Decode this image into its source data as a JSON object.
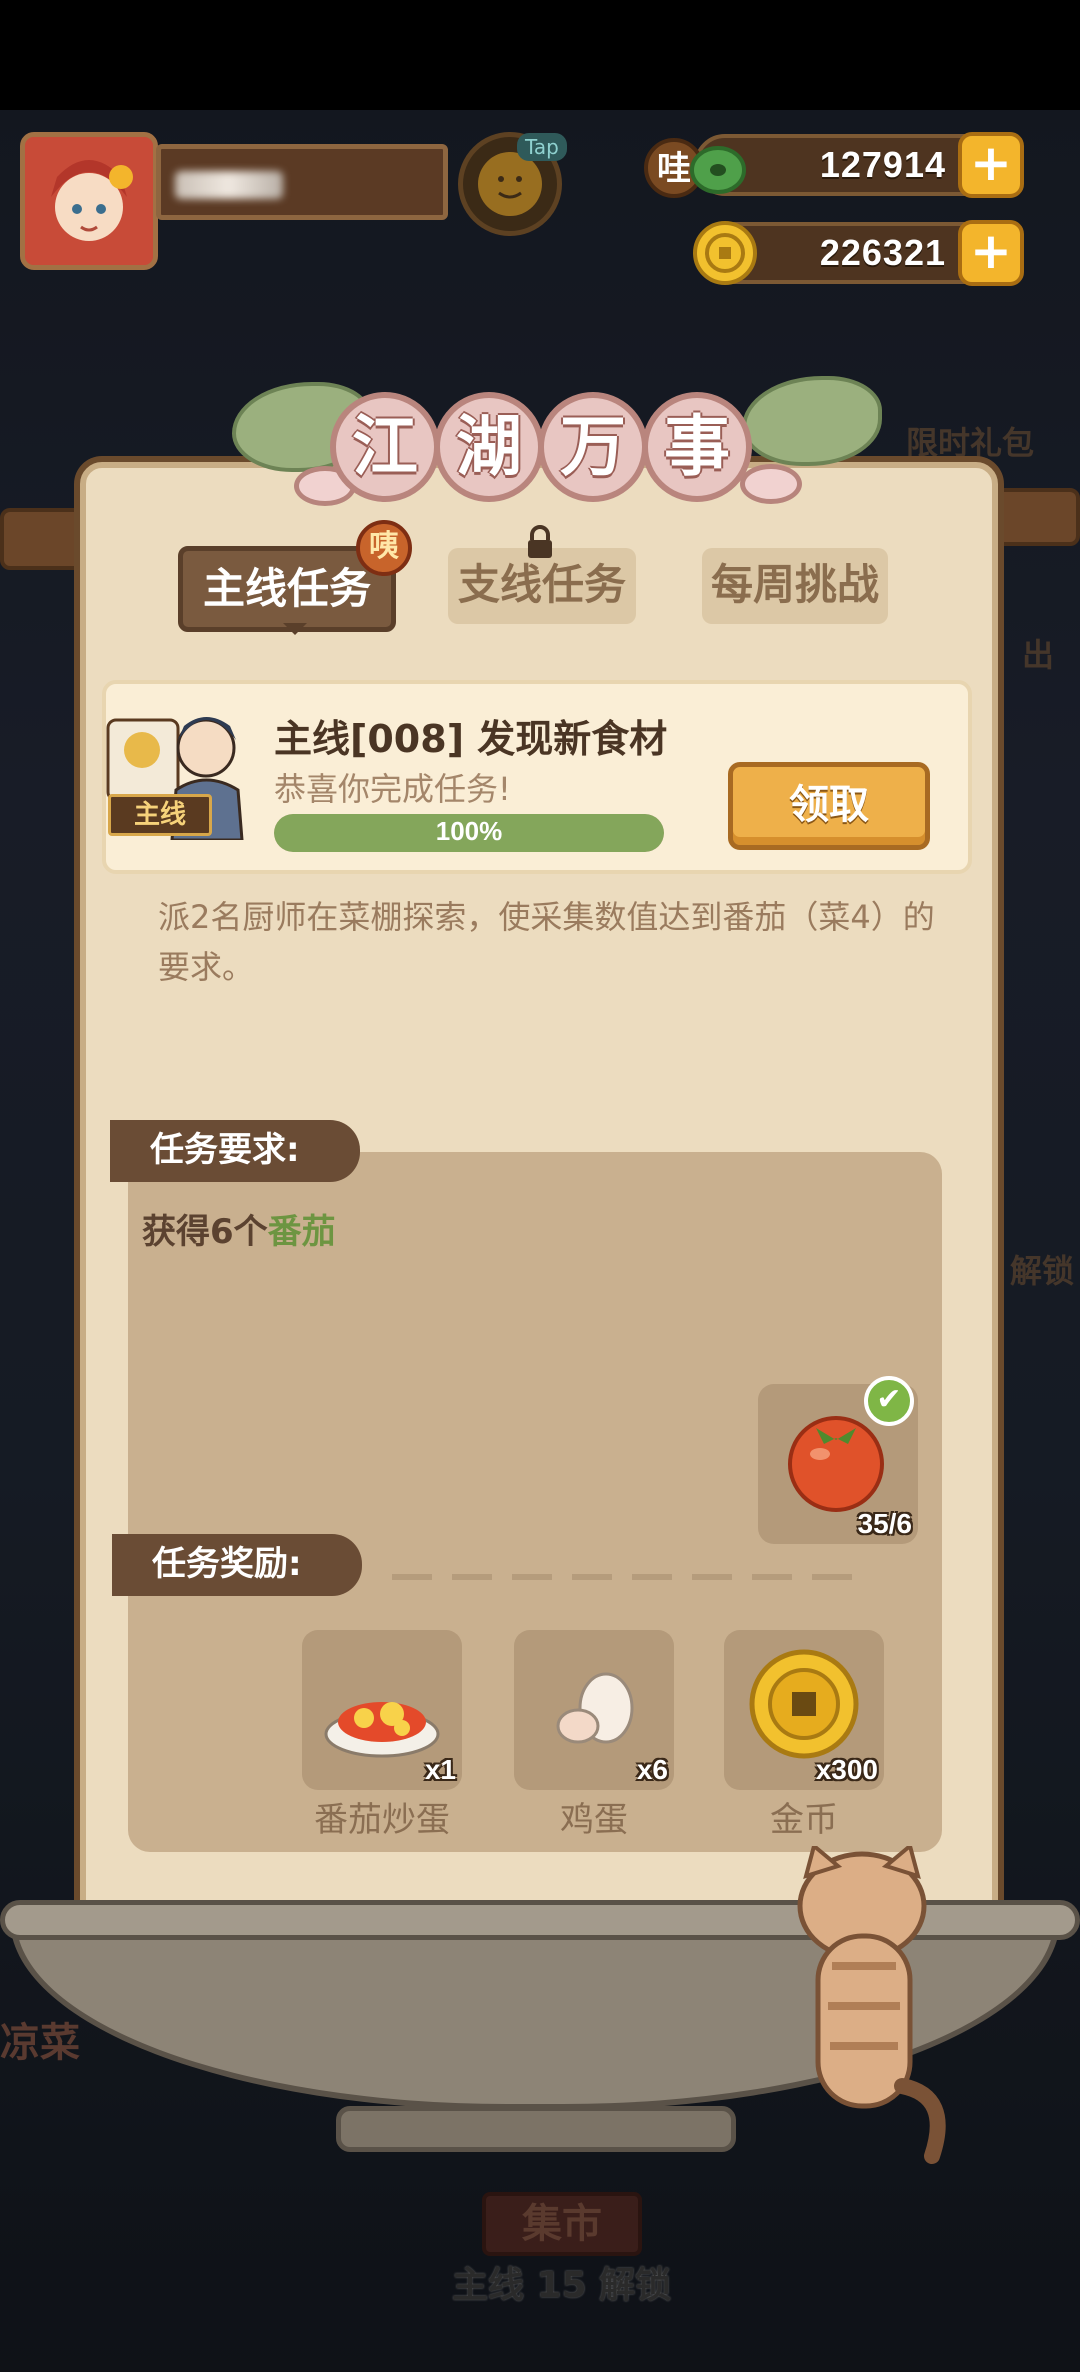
{
  "hud": {
    "jade_value": "127914",
    "gold_value": "226321",
    "plus_label": "+",
    "jade_badge": "哇",
    "face_tag": "Tap"
  },
  "panel": {
    "title_chars": [
      "江",
      "湖",
      "万",
      "事"
    ],
    "tabs": [
      {
        "label": "主线任务",
        "active": true
      },
      {
        "label": "支线任务",
        "locked": true
      },
      {
        "label": "每周挑战"
      }
    ],
    "tab_badge": "咦"
  },
  "task": {
    "tag": "主线",
    "title": "主线[008] 发现新食材",
    "subtitle": "恭喜你完成任务!",
    "progress": 1.0,
    "progress_label": "100%",
    "claim_label": "领取",
    "description": "派2名厨师在菜棚探索，使采集数值达到番茄（菜4）的要求。"
  },
  "requirement": {
    "section_label": "任务要求:",
    "text_prefix": "获得6个",
    "text_highlight": "番茄",
    "item_count": "35/6",
    "item_icon": "tomato-icon",
    "done_mark": "✔"
  },
  "rewards": {
    "section_label": "任务奖励:",
    "items": [
      {
        "name": "番茄炒蛋",
        "count": "x1",
        "icon": "tomato-egg-dish-icon"
      },
      {
        "name": "鸡蛋",
        "count": "x6",
        "icon": "egg-icon"
      },
      {
        "name": "金币",
        "count": "x300",
        "icon": "gold-coin-icon"
      }
    ]
  },
  "background": {
    "bottom_text": "主线 15 解锁",
    "market_label": "集市",
    "side_labels": [
      "限时礼包",
      "出",
      "解锁",
      "凉菜"
    ]
  },
  "colors": {
    "accent": "#eeb04a",
    "panel": "#ecdcbf",
    "progress_fill": "#84a65b",
    "highlight_green": "#6d9541"
  }
}
